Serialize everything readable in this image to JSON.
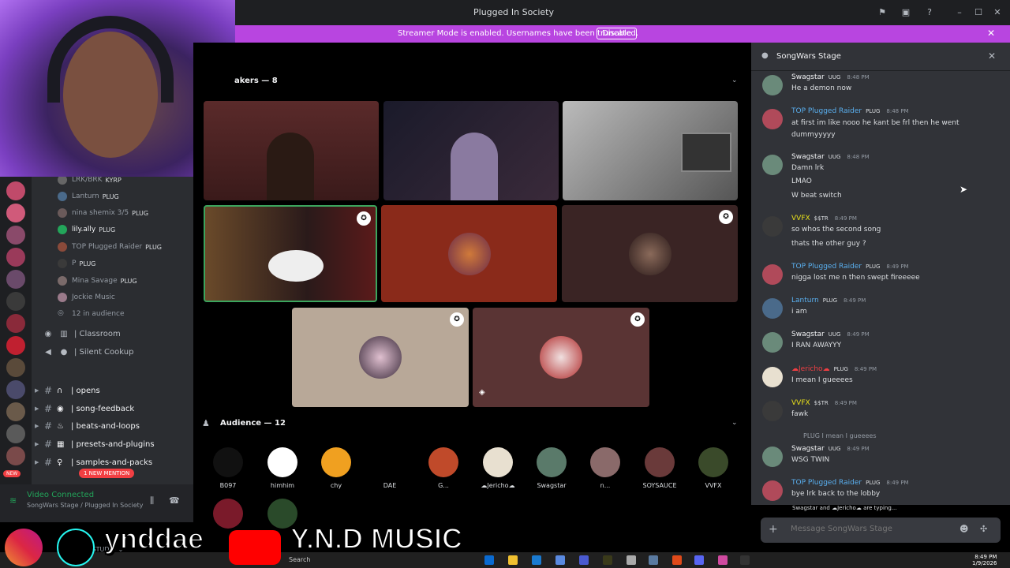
{
  "window": {
    "title": "Plugged In Society"
  },
  "streamer_bar": {
    "message": "Streamer Mode is enabled. Usernames have been truncated.",
    "button": "Disable"
  },
  "channels": {
    "voice_users": [
      {
        "name": "LRK/BRK",
        "tag": "KYRP"
      },
      {
        "name": "Lanturn",
        "tag": "PLUG"
      },
      {
        "name": "nina shemix 3/5",
        "tag": "PLUG"
      },
      {
        "name": "lily.ally",
        "tag": "PLUG"
      },
      {
        "name": "TOP Plugged Raider",
        "tag": "PLUG"
      },
      {
        "name": "P",
        "tag": "PLUG"
      },
      {
        "name": "Mina Savage",
        "tag": "PLUG"
      },
      {
        "name": "Jockie Music",
        "tag": ""
      }
    ],
    "audience_count": "12 in audience",
    "voice_channels": [
      "| Classroom",
      "| Silent Cookup"
    ],
    "category": "THE STUDIO",
    "text_channels": [
      "| opens",
      "| song-feedback",
      "| beats-and-loops",
      "| presets-and-plugins",
      "| samples-and-packs"
    ],
    "new_badge": "NEW",
    "mention_badge": "1 NEW MENTION"
  },
  "voice_panel": {
    "status": "Video Connected",
    "location": "SongWars Stage / Plugged In Society"
  },
  "stage": {
    "speakers_label": "akers — 8",
    "audience_label": "Audience — 12",
    "audience": [
      "B097",
      "himhim",
      "chy",
      "DAE",
      "G...",
      "☁Jericho☁",
      "Swagstar",
      "n...",
      "SOYSAUCE",
      "VVFX"
    ]
  },
  "chat": {
    "title": "SongWars Stage",
    "messages": [
      {
        "name": "Swagstar",
        "tag": "UUG",
        "time": "8:48 PM",
        "color": "#f2f3f5",
        "lines": [
          "He a demon now"
        ]
      },
      {
        "name": "TOP Plugged Raider",
        "tag": "PLUG",
        "time": "8:48 PM",
        "color": "#5ab0f0",
        "lines": [
          "at first im like nooo he kant be frl then he went",
          "dummyyyyy"
        ]
      },
      {
        "name": "Swagstar",
        "tag": "UUG",
        "time": "8:48 PM",
        "color": "#f2f3f5",
        "lines": [
          "Damn lrk",
          "LMAO",
          "W beat switch"
        ]
      },
      {
        "name": "VVFX",
        "tag": "$$TR",
        "time": "8:49 PM",
        "color": "#e8e01a",
        "lines": [
          "so whos the second song",
          "thats the other guy ?"
        ]
      },
      {
        "name": "TOP Plugged Raider",
        "tag": "PLUG",
        "time": "8:49 PM",
        "color": "#5ab0f0",
        "lines": [
          "nigga lost me n then swept fireeeee"
        ]
      },
      {
        "name": "Lanturn",
        "tag": "PLUG",
        "time": "8:49 PM",
        "color": "#5ab0f0",
        "lines": [
          "i am"
        ]
      },
      {
        "name": "Swagstar",
        "tag": "UUG",
        "time": "8:49 PM",
        "color": "#f2f3f5",
        "lines": [
          "I RAN AWAYYY"
        ]
      },
      {
        "name": "☁Jericho☁",
        "tag": "PLUG",
        "time": "8:49 PM",
        "color": "#f23f43",
        "lines": [
          "I mean I gueeees"
        ]
      },
      {
        "name": "VVFX",
        "tag": "$$TR",
        "time": "8:49 PM",
        "color": "#e8e01a",
        "lines": [
          "fawk"
        ]
      },
      {
        "name": "Swagstar",
        "tag": "UUG",
        "time": "8:49 PM",
        "color": "#f2f3f5",
        "lines": [
          "WSG TWIN"
        ]
      },
      {
        "name": "TOP Plugged Raider",
        "tag": "PLUG",
        "time": "8:49 PM",
        "color": "#5ab0f0",
        "lines": [
          "bye lrk back to the lobby"
        ]
      }
    ],
    "reply_preview": "PLUG  I mean I gueeees",
    "typing": "Swagstar and ☁Jericho☁ are typing...",
    "input_placeholder": "Message SongWars Stage"
  },
  "overlay": {
    "handle": "ynddae",
    "channel": "Y.N.D MUSIC"
  },
  "taskbar": {
    "search": "Search",
    "time": "8:49 PM",
    "date": "1/9/2026"
  }
}
